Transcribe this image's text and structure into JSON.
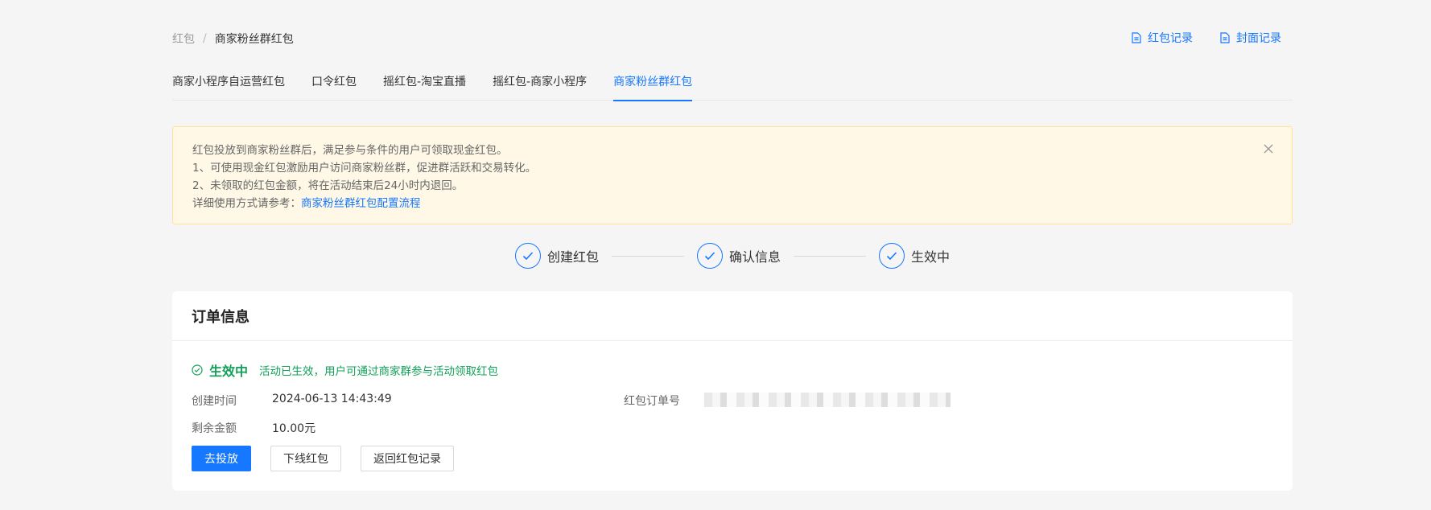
{
  "breadcrumb": {
    "parent": "红包",
    "separator": "/",
    "current": "商家粉丝群红包"
  },
  "top_links": {
    "redpacket_records": "红包记录",
    "cover_records": "封面记录"
  },
  "tabs": [
    {
      "label": "商家小程序自运营红包"
    },
    {
      "label": "口令红包"
    },
    {
      "label": "摇红包-淘宝直播"
    },
    {
      "label": "摇红包-商家小程序"
    },
    {
      "label": "商家粉丝群红包",
      "active": true
    }
  ],
  "alert": {
    "line1": "红包投放到商家粉丝群后，满足参与条件的用户可领取现金红包。",
    "line2": "1、可使用现金红包激励用户访问商家粉丝群，促进群活跃和交易转化。",
    "line3": "2、未领取的红包金额，将在活动结束后24小时内退回。",
    "line4_prefix": "详细使用方式请参考：",
    "line4_link": "商家粉丝群红包配置流程"
  },
  "steps": [
    {
      "label": "创建红包"
    },
    {
      "label": "确认信息"
    },
    {
      "label": "生效中"
    }
  ],
  "order": {
    "title": "订单信息",
    "status": "生效中",
    "status_desc": "活动已生效，用户可通过商家群参与活动领取红包",
    "created_label": "创建时间",
    "created_value": "2024-06-13 14:43:49",
    "remaining_label": "剩余金额",
    "remaining_value": "10.00元",
    "order_no_label": "红包订单号"
  },
  "buttons": {
    "deploy": "去投放",
    "offline": "下线红包",
    "back": "返回红包记录"
  },
  "colors": {
    "primary": "#1677ff",
    "success": "#12a15a",
    "alert_bg": "#fff8e6",
    "alert_border": "#ffe19a"
  }
}
